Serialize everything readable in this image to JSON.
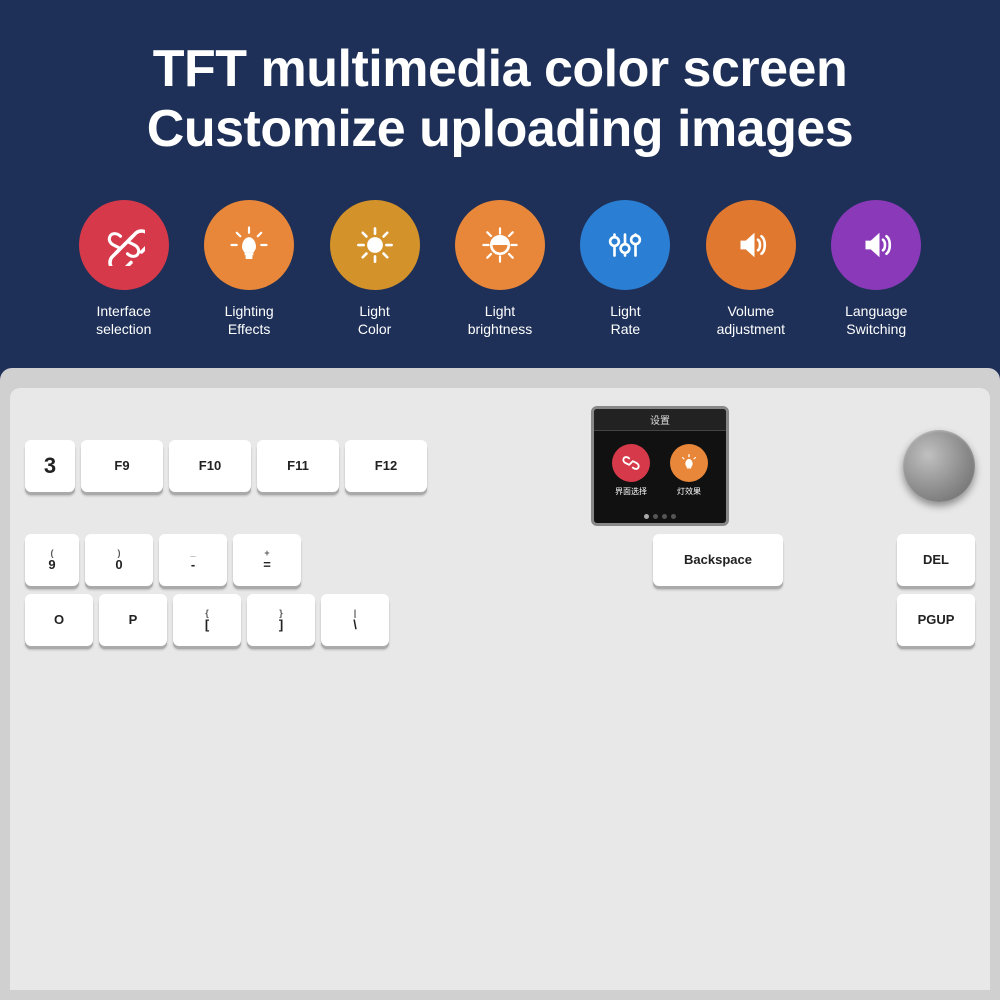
{
  "headline": {
    "line1": "TFT multimedia color screen",
    "line2": "Customize uploading images"
  },
  "features": [
    {
      "id": "interface-selection",
      "icon": "link",
      "colorClass": "icon-red",
      "label": "Interface\nselection"
    },
    {
      "id": "lighting-effects",
      "icon": "bulb",
      "colorClass": "icon-orange-light",
      "label": "Lighting\nEffects"
    },
    {
      "id": "light-color",
      "icon": "sun",
      "colorClass": "icon-orange-gold",
      "label": "Light\nColor"
    },
    {
      "id": "light-brightness",
      "icon": "brightness",
      "colorClass": "icon-orange-dark",
      "label": "Light\nbrightness"
    },
    {
      "id": "light-rate",
      "icon": "sliders",
      "colorClass": "icon-blue",
      "label": "Light\nRate"
    },
    {
      "id": "volume-adjustment",
      "icon": "volume",
      "colorClass": "icon-orange-volume",
      "label": "Volume\nadjustment"
    },
    {
      "id": "language-switching",
      "icon": "language",
      "colorClass": "icon-purple",
      "label": "Language\nSwitching"
    }
  ],
  "tft": {
    "title": "设置",
    "icon1_label": "界面选择",
    "icon2_label": "灯效果"
  },
  "keyboard": {
    "fn_keys": [
      "F9",
      "F10",
      "F11",
      "F12"
    ],
    "b3_label": "3",
    "backspace_label": "Backspace",
    "del_label": "DEL",
    "num_keys": [
      "9",
      "0",
      "-",
      "="
    ],
    "num_symbols": [
      "(",
      ")",
      "-",
      "+"
    ],
    "letter_keys": [
      "O",
      "P",
      "{",
      "}",
      "!"
    ],
    "letter_sub": [
      "",
      "",
      "[",
      "]",
      "\\"
    ],
    "pgup_label": "PGUP"
  },
  "colors": {
    "background": "#1e3057",
    "keyboard_bg": "#d0d0d0",
    "key_bg": "#ffffff",
    "accent_red": "#d63a4a",
    "accent_orange": "#e8873a",
    "accent_gold": "#d4922a",
    "accent_blue": "#2a7fd4",
    "accent_purple": "#8a3ab9"
  }
}
